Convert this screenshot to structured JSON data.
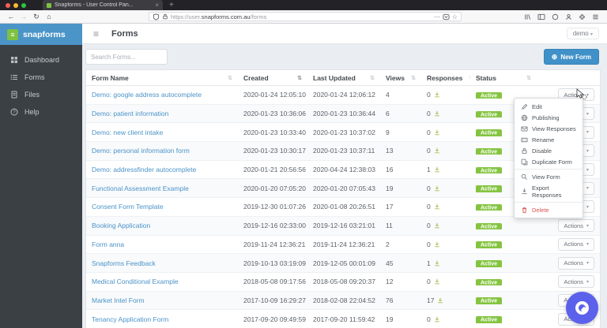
{
  "browser": {
    "tab_title": "Snapforms - User Control Pan...",
    "close_tab_glyph": "×",
    "new_tab_glyph": "+",
    "back_glyph": "←",
    "forward_glyph": "→",
    "refresh_glyph": "↻",
    "home_glyph": "⌂",
    "url_prefix": "https://user.",
    "url_domain": "snapforms.com.au",
    "url_path": "/forms",
    "overflow_glyph": "⋯",
    "star_glyph": "☆"
  },
  "sidebar": {
    "brand": "snapforms",
    "items": [
      {
        "label": "Dashboard",
        "icon": "dashboard-icon"
      },
      {
        "label": "Forms",
        "icon": "forms-icon"
      },
      {
        "label": "Files",
        "icon": "files-icon"
      },
      {
        "label": "Help",
        "icon": "help-icon"
      }
    ]
  },
  "header": {
    "title": "Forms",
    "account_label": "demo"
  },
  "controls": {
    "search_placeholder": "Search Forms...",
    "new_form_label": "New Form"
  },
  "table": {
    "columns": [
      "Form Name",
      "Created",
      "Last Updated",
      "Views",
      "Responses",
      "Status"
    ],
    "actions_label": "Actions",
    "rows": [
      {
        "name": "Demo: google address autocomplete",
        "created": "2020-01-24 12:05:10",
        "updated": "2020-01-24 12:06:12",
        "views": "4",
        "responses": "0",
        "status": "Active"
      },
      {
        "name": "Demo: patient information",
        "created": "2020-01-23 10:36:06",
        "updated": "2020-01-23 10:36:44",
        "views": "6",
        "responses": "0",
        "status": "Active"
      },
      {
        "name": "Demo: new client intake",
        "created": "2020-01-23 10:33:40",
        "updated": "2020-01-23 10:37:02",
        "views": "9",
        "responses": "0",
        "status": "Active"
      },
      {
        "name": "Demo: personal information form",
        "created": "2020-01-23 10:30:17",
        "updated": "2020-01-23 10:37:11",
        "views": "13",
        "responses": "0",
        "status": "Active"
      },
      {
        "name": "Demo: addressfinder autocomplete",
        "created": "2020-01-21 20:56:56",
        "updated": "2020-04-24 12:38:03",
        "views": "16",
        "responses": "1",
        "status": "Active"
      },
      {
        "name": "Functional Assessment Example",
        "created": "2020-01-20 07:05:20",
        "updated": "2020-01-20 07:05:43",
        "views": "19",
        "responses": "0",
        "status": "Active"
      },
      {
        "name": "Consent Form Template",
        "created": "2019-12-30 01:07:26",
        "updated": "2020-01-08 20:26:51",
        "views": "17",
        "responses": "0",
        "status": "Active"
      },
      {
        "name": "Booking Application",
        "created": "2019-12-16 02:33:00",
        "updated": "2019-12-16 03:21:01",
        "views": "11",
        "responses": "0",
        "status": "Active"
      },
      {
        "name": "Form anna",
        "created": "2019-11-24 12:36:21",
        "updated": "2019-11-24 12:36:21",
        "views": "2",
        "responses": "0",
        "status": "Active"
      },
      {
        "name": "Snapforms Feedback",
        "created": "2019-10-13 03:19:09",
        "updated": "2019-12-05 00:01:09",
        "views": "45",
        "responses": "1",
        "status": "Active"
      },
      {
        "name": "Medical Conditional Example",
        "created": "2018-05-08 09:17:56",
        "updated": "2018-05-08 09:20:37",
        "views": "12",
        "responses": "0",
        "status": "Active"
      },
      {
        "name": "Market Intel Form",
        "created": "2017-10-09 16:29:27",
        "updated": "2018-02-08 22:04:52",
        "views": "76",
        "responses": "17",
        "status": "Active"
      },
      {
        "name": "Tenancy Application Form",
        "created": "2017-09-20 09:49:59",
        "updated": "2017-09-20 11:59:42",
        "views": "19",
        "responses": "0",
        "status": "Active"
      }
    ]
  },
  "actions_menu": {
    "items": [
      {
        "label": "Edit",
        "icon": "pencil-icon"
      },
      {
        "label": "Publishing",
        "icon": "globe-icon"
      },
      {
        "label": "View Responses",
        "icon": "envelope-icon"
      },
      {
        "label": "Rename",
        "icon": "rename-icon"
      },
      {
        "label": "Disable",
        "icon": "lock-icon"
      },
      {
        "label": "Duplicate Form",
        "icon": "copy-icon"
      },
      {
        "label": "View Form",
        "icon": "magnifier-icon"
      },
      {
        "label": "Export Responses",
        "icon": "download-icon"
      },
      {
        "label": "Delete",
        "icon": "trash-icon"
      }
    ]
  },
  "colors": {
    "accent_blue": "#4191c9",
    "brand_green": "#7ec142",
    "header_blue": "#4a94c8",
    "sidebar_dark": "#3b4045",
    "active_green": "#85c441",
    "link_blue": "#4b93c9",
    "danger_red": "#d9534f",
    "chat_purple": "#5b61eb"
  }
}
